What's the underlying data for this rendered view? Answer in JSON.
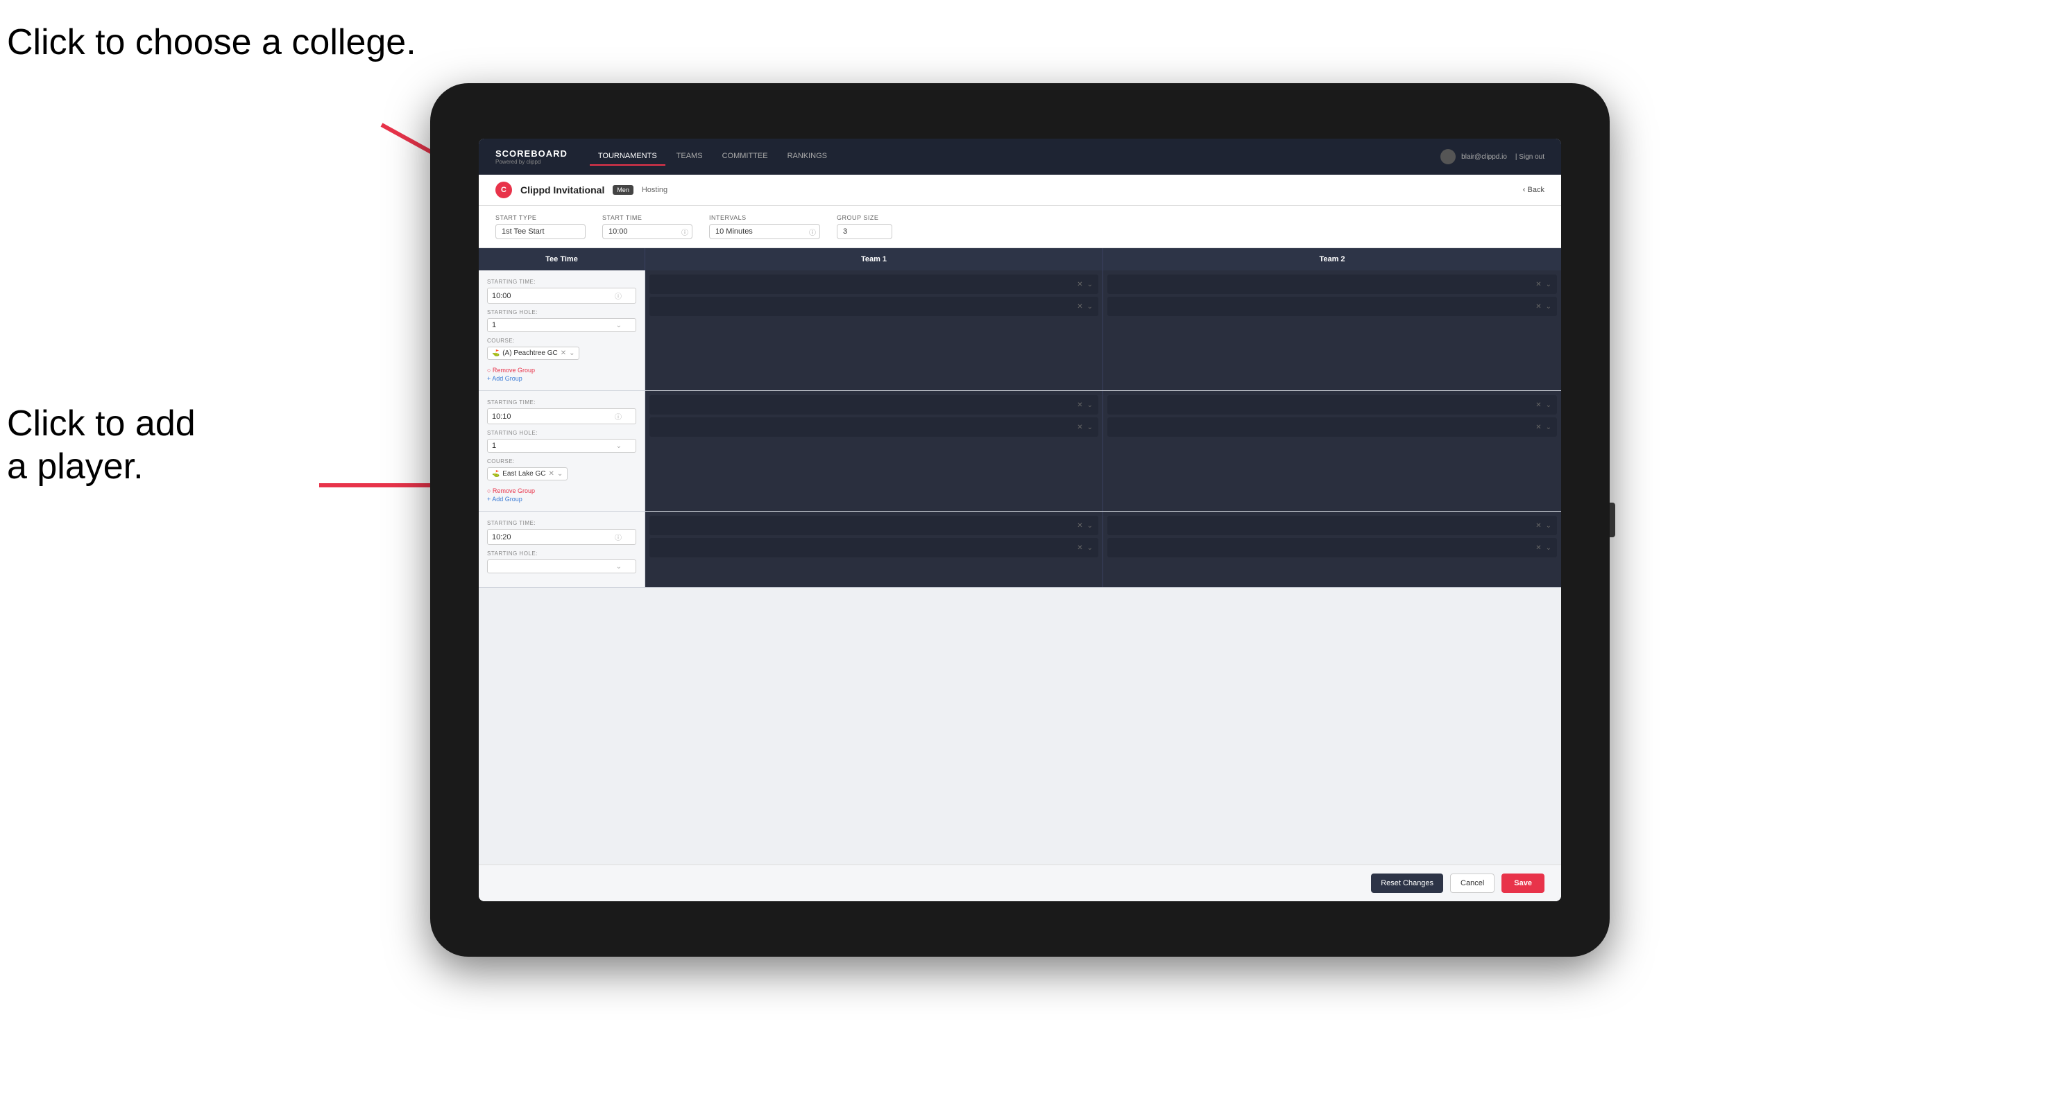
{
  "annotations": {
    "choose_college": "Click to choose a\ncollege.",
    "add_player": "Click to add\na player."
  },
  "navbar": {
    "brand": "SCOREBOARD",
    "brand_sub": "Powered by clippd",
    "nav_items": [
      "TOURNAMENTS",
      "TEAMS",
      "COMMITTEE",
      "RANKINGS"
    ],
    "active_nav": "TOURNAMENTS",
    "user_email": "blair@clippd.io",
    "sign_out": "Sign out"
  },
  "sub_header": {
    "tournament_name": "Clippd Invitational",
    "gender": "Men",
    "hosting": "Hosting",
    "back": "Back"
  },
  "settings": {
    "start_type_label": "Start Type",
    "start_type_value": "1st Tee Start",
    "start_time_label": "Start Time",
    "start_time_value": "10:00",
    "intervals_label": "Intervals",
    "intervals_value": "10 Minutes",
    "group_size_label": "Group Size",
    "group_size_value": "3"
  },
  "table_headers": {
    "tee_time": "Tee Time",
    "team1": "Team 1",
    "team2": "Team 2"
  },
  "groups": [
    {
      "starting_time": "10:00",
      "starting_hole": "1",
      "course": "(A) Peachtree GC",
      "team1_players": 2,
      "team2_players": 2
    },
    {
      "starting_time": "10:10",
      "starting_hole": "1",
      "course": "East Lake GC",
      "team1_players": 2,
      "team2_players": 2
    },
    {
      "starting_time": "10:20",
      "starting_hole": "",
      "course": "",
      "team1_players": 2,
      "team2_players": 2
    }
  ],
  "footer": {
    "reset_label": "Reset Changes",
    "cancel_label": "Cancel",
    "save_label": "Save"
  },
  "colors": {
    "accent": "#e8334a",
    "dark_nav": "#1e2433",
    "table_dark": "#2a2f3e",
    "player_dark": "#232836"
  }
}
